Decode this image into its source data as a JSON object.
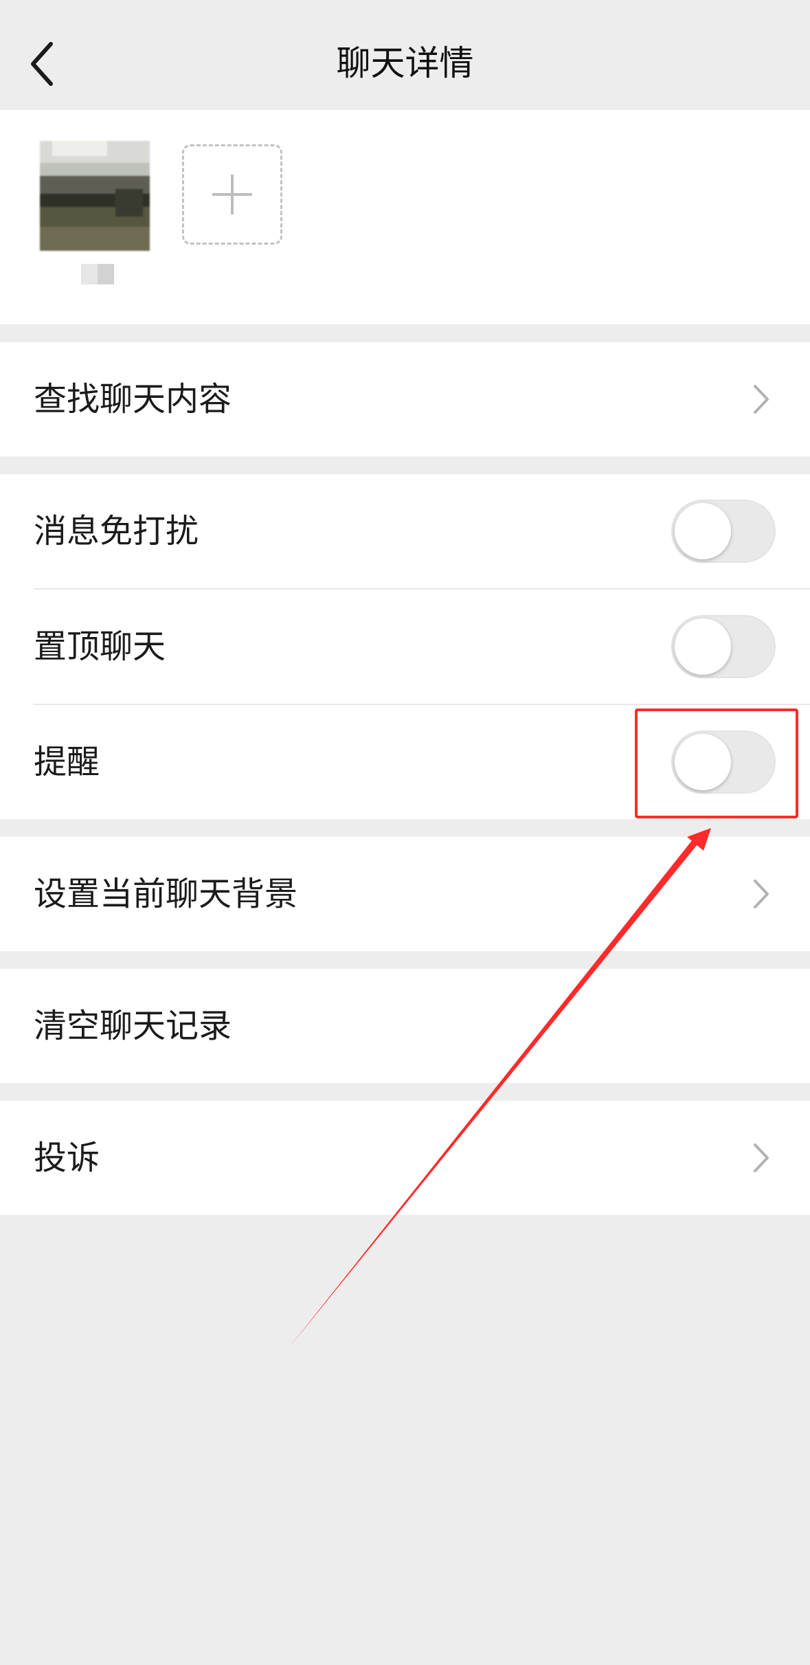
{
  "nav": {
    "back_icon": "chevron-left-icon",
    "title": "聊天详情"
  },
  "members": {
    "add_icon": "plus-icon"
  },
  "menu": {
    "search_chat": "查找聊天内容",
    "mute": "消息免打扰",
    "pin": "置顶聊天",
    "remind": "提醒",
    "set_background": "设置当前聊天背景",
    "clear_history": "清空聊天记录",
    "report": "投诉"
  },
  "toggles": {
    "mute": false,
    "pin": false,
    "remind": false
  },
  "colors": {
    "annotation": "#ff2a2a",
    "background": "#ededed",
    "toggle_off": "#e9e9e9"
  }
}
